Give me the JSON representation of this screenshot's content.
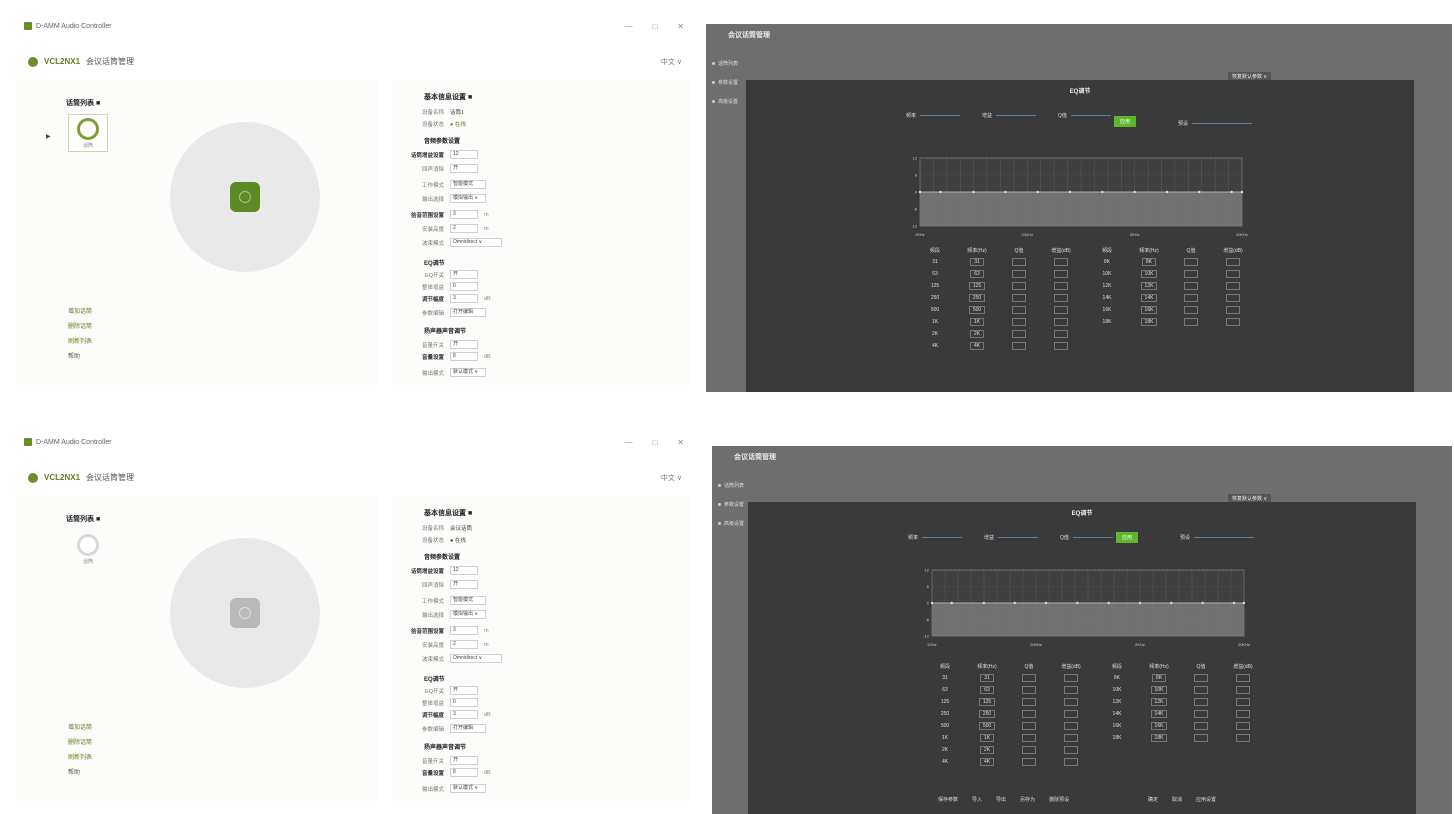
{
  "window": {
    "title": "D-AMM Audio Controller",
    "controls": {
      "minimize": "—",
      "maximize": "□",
      "close": "✕"
    },
    "brand": "VCL2NX1",
    "page_title": "会议话筒管理",
    "language": "中文 ∨"
  },
  "devices": {
    "list_title": "话筒列表 ■",
    "item_label": "话筒",
    "pointer": "▶",
    "links": [
      "增加话筒",
      "删除话筒",
      "刷新列表",
      "帮助"
    ]
  },
  "settings": {
    "basic_title": "基本信息设置 ■",
    "device_name_label": "设备名称",
    "device_name_value_top": "话筒1",
    "device_name_value_bottom": "会议话筒",
    "device_status_label": "设备状态",
    "device_status_value": "● 在线",
    "audio_title": "音频参数设置",
    "mic_gain_label": "话筒增益设置",
    "mic_gain_value": "12",
    "loop_label": "回声消除",
    "loop_value": "开",
    "mode_label": "工作模式",
    "mode_value": "智能模式",
    "output_label": "输出选择",
    "output_value": "模拟输出 ∨",
    "range_title": "拾音范围设置",
    "range_value": "3",
    "range_unit": "m",
    "height_label": "安装高度",
    "height_value": "2",
    "height_unit": "m",
    "beam_label": "波束模式",
    "beam_value": "Omnidirect ∨",
    "eq_title": "EQ调节",
    "eq_switch_label": "EQ开关",
    "eq_switch_value": "开",
    "eq_gain_label": "整体增益",
    "eq_gain_value": "0",
    "eq_level_label": "调节幅度",
    "eq_level_value": "3",
    "eq_level_unit": "dB",
    "eq_edit_label": "参数编辑",
    "eq_edit_value": "打开编辑",
    "speaker_title": "扬声器声音调节",
    "spk_switch_label": "音量开关",
    "spk_switch_value": "开",
    "spk_vol_label": "音量设置",
    "spk_vol_value": "8",
    "spk_vol_unit": "dB",
    "spk_mode_label": "输出模式",
    "spk_mode_value": "默认模式 ∨"
  },
  "eq_window": {
    "title": "会议话筒管理",
    "menu": [
      "话筒列表",
      "参数设置",
      "高级设置"
    ],
    "top_button": "恢复默认参数 ∨",
    "dialog_title": "EQ调节",
    "top_controls": [
      "频率",
      "增益",
      "Q值"
    ],
    "apply_button": "应用",
    "preset_label": "预设",
    "columns": [
      "频段",
      "频率(Hz)",
      "Q值",
      "增益(dB)"
    ],
    "bands_left": [
      "31",
      "63",
      "125",
      "250",
      "500",
      "1K",
      "2K",
      "4K"
    ],
    "bands_right": [
      "8K",
      "10K",
      "12K",
      "14K",
      "16K",
      "18K"
    ],
    "axis_x": [
      "20Hz",
      "200Hz",
      "2KHz",
      "20KHz"
    ],
    "axis_y": [
      "12",
      "6",
      "0",
      "-6",
      "-12"
    ],
    "footer_left": [
      "保存参数",
      "导入",
      "导出",
      "另存为",
      "删除预设"
    ],
    "footer_right": [
      "确定",
      "取消",
      "应用设置"
    ]
  },
  "chart_data": {
    "type": "line",
    "x": [
      20,
      31,
      63,
      125,
      250,
      500,
      1000,
      2000,
      4000,
      8000,
      16000,
      20000
    ],
    "series": [
      {
        "values": [
          0,
          0,
          0,
          0,
          0,
          0,
          0,
          0,
          0,
          0,
          0,
          0
        ]
      }
    ],
    "xlabel": "",
    "ylabel": "",
    "ylim": [
      -12,
      12
    ],
    "grid": true
  }
}
